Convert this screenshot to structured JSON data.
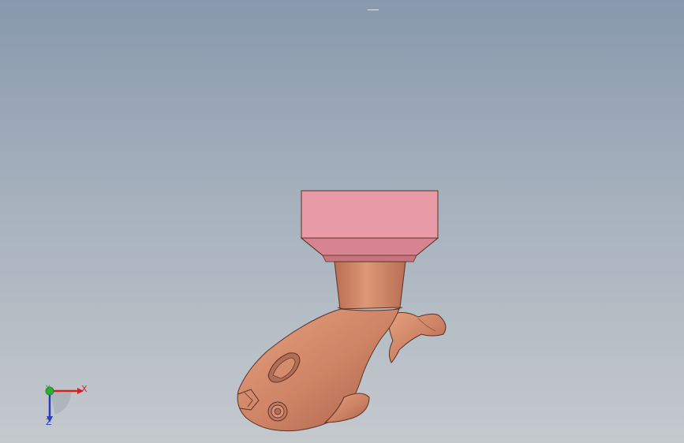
{
  "viewport": {
    "background_top": "#8899ad",
    "background_bottom": "#c4c9cd"
  },
  "model": {
    "icon": "fish-leg-3d-model-icon",
    "base_color": "#e89aa7",
    "body_color": "#cd8264",
    "edge_color": "#5a3328"
  },
  "triad": {
    "x_label": "X",
    "y_label": "Y",
    "z_label": "Z",
    "x_color": "#d42020",
    "y_color": "#1f9a2a",
    "z_color": "#2a3fbf"
  }
}
